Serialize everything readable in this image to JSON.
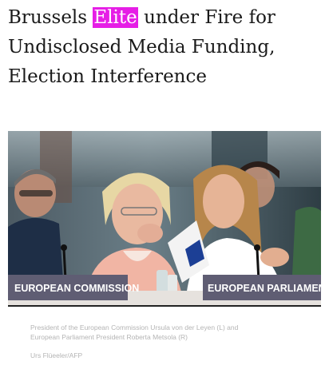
{
  "article": {
    "headline": {
      "line1_before": "Brussels ",
      "line1_highlight": "Elite",
      "line1_after": " under Fire for",
      "line2": "Undisclosed Media Funding,",
      "line3": "Election Interference"
    },
    "photo": {
      "sign_left": "EUROPEAN COMMISSION",
      "sign_right": "EUROPEAN PARLIAMENT"
    },
    "caption": {
      "line1": "President of the European Commission Ursula von der Leyen (L) and",
      "line2": "European Parliament President Roberta Metsola (R)"
    },
    "credit": "Urs Flüeeler/AFP"
  },
  "colors": {
    "highlight": "#e61ee6",
    "headline_text": "#1a1a1a",
    "caption_text": "#b4b4b4"
  }
}
